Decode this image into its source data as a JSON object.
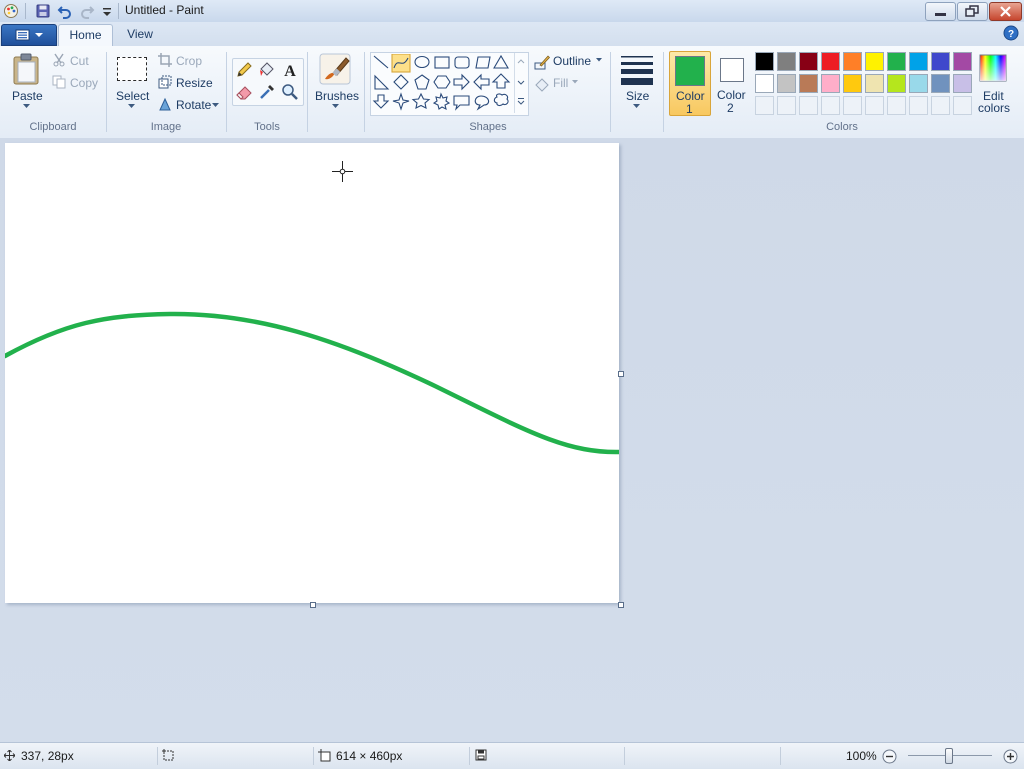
{
  "window": {
    "title": "Untitled - Paint"
  },
  "tabs": [
    {
      "label": "Home",
      "active": true
    },
    {
      "label": "View",
      "active": false
    }
  ],
  "clipboard": {
    "paste": "Paste",
    "cut": "Cut",
    "copy": "Copy",
    "group": "Clipboard"
  },
  "image": {
    "select": "Select",
    "crop": "Crop",
    "resize": "Resize",
    "rotate": "Rotate",
    "group": "Image"
  },
  "tools": {
    "group": "Tools"
  },
  "brushes": {
    "label": "Brushes"
  },
  "shapes": {
    "outline": "Outline",
    "fill": "Fill",
    "group": "Shapes"
  },
  "size": {
    "label": "Size"
  },
  "color1": {
    "line1": "Color",
    "line2": "1",
    "value": "#22b14c"
  },
  "color2": {
    "line1": "Color",
    "line2": "2",
    "value": "#ffffff"
  },
  "colors": {
    "group": "Colors",
    "edit_line1": "Edit",
    "edit_line2": "colors",
    "row1": [
      "#000000",
      "#7f7f7f",
      "#880015",
      "#ed1c24",
      "#ff7f27",
      "#fff200",
      "#22b14c",
      "#00a2e8",
      "#3f48cc",
      "#a349a4"
    ],
    "row2": [
      "#ffffff",
      "#c3c3c3",
      "#b97a57",
      "#ffaec9",
      "#ffc90e",
      "#efe4b0",
      "#b5e61d",
      "#99d9ea",
      "#7092be",
      "#c8bfe7"
    ]
  },
  "status": {
    "cursor_pos": "337, 28px",
    "canvas_size": "614 × 460px",
    "zoom": "100%",
    "zoom_level": 1.0
  },
  "drawing": {
    "stroke_color": "#22b14c"
  }
}
